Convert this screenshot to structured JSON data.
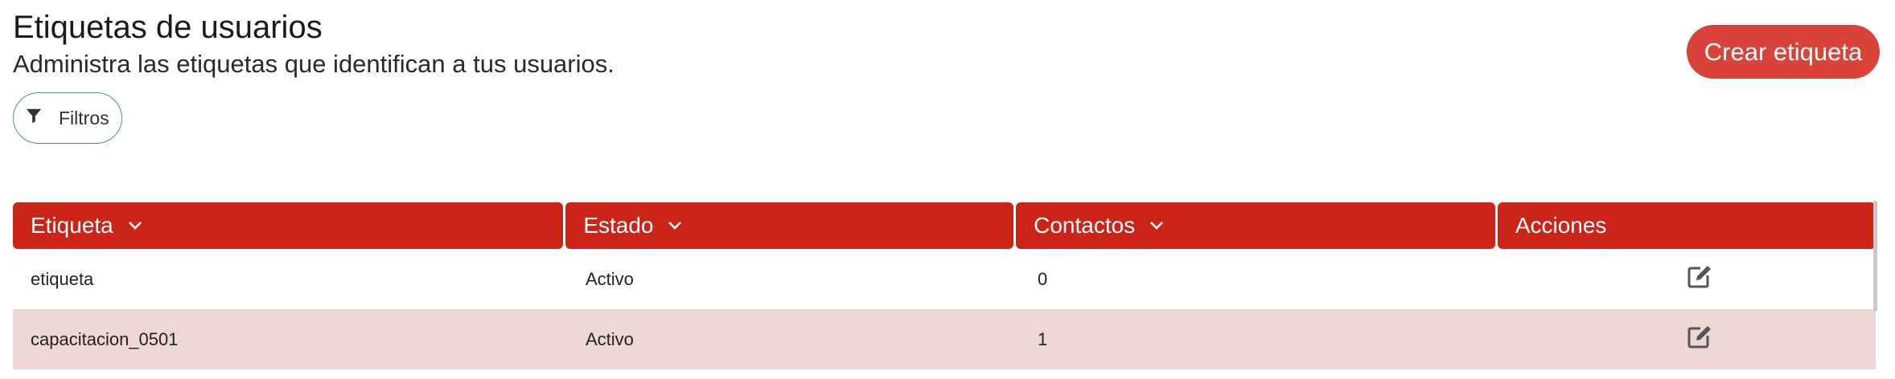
{
  "header": {
    "title": "Etiquetas de usuarios",
    "subtitle": "Administra las etiquetas que identifican a tus usuarios.",
    "create_label": "Crear etiqueta"
  },
  "filters": {
    "label": "Filtros",
    "icon": "filter-icon"
  },
  "colors": {
    "accent": "#cb2418",
    "button": "#d9433a",
    "row_alt": "#edd8d6",
    "filter_border": "#4a8f9a"
  },
  "table": {
    "columns": [
      "Etiqueta",
      "Estado",
      "Contactos",
      "Acciones"
    ],
    "rows": [
      {
        "etiqueta": "etiqueta",
        "estado": "Activo",
        "contactos": "0",
        "action_icon": "edit-icon"
      },
      {
        "etiqueta": "capacitacion_0501",
        "estado": "Activo",
        "contactos": "1",
        "action_icon": "edit-icon"
      }
    ]
  }
}
